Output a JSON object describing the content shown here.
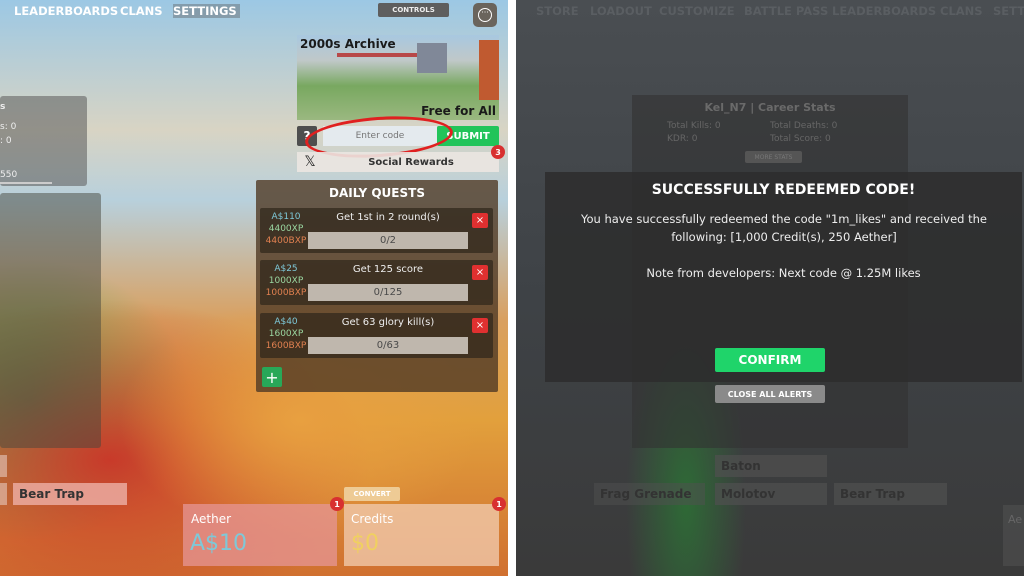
{
  "left": {
    "nav": [
      "LEADERBOARDS",
      "CLANS",
      "SETTINGS"
    ],
    "controls_label": "CONTROLS",
    "menu_icon": "ellipsis-icon",
    "map": {
      "name": "2000s Archive",
      "mode": "Free for All"
    },
    "code": {
      "placeholder": "Enter code",
      "submit": "SUBMIT",
      "help_icon": "question-icon"
    },
    "social": {
      "label": "Social Rewards",
      "icon": "x-logo-icon",
      "badge": "3"
    },
    "stats_partial": [
      "s",
      "s: 0",
      ": 0",
      "550"
    ],
    "quests": {
      "title": "DAILY QUESTS",
      "items": [
        {
          "aether": "A$110",
          "xp": "4400XP",
          "bxp": "4400BXP",
          "task": "Get 1st in 2 round(s)",
          "progress": "0/2"
        },
        {
          "aether": "A$25",
          "xp": "1000XP",
          "bxp": "1000BXP",
          "task": "Get 125 score",
          "progress": "0/125"
        },
        {
          "aether": "A$40",
          "xp": "1600XP",
          "bxp": "1600BXP",
          "task": "Get 63 glory kill(s)",
          "progress": "0/63"
        }
      ],
      "remove_label": "×",
      "add_label": "+"
    },
    "loadout_item": "Bear Trap",
    "currency": {
      "convert": "CONVERT",
      "aether": {
        "label": "Aether",
        "value": "A$10",
        "badge": "1"
      },
      "credits": {
        "label": "Credits",
        "value": "$0",
        "badge": "1"
      }
    }
  },
  "right": {
    "nav": [
      "STORE",
      "LOADOUT",
      "CUSTOMIZE",
      "BATTLE PASS",
      "LEADERBOARDS",
      "CLANS",
      "SETTI"
    ],
    "career": {
      "title": "Kel_N7 | Career Stats",
      "kills": "Total Kills: 0",
      "deaths": "Total Deaths: 0",
      "kdr": "KDR: 0",
      "score": "Total Score: 0",
      "more": "MORE STATS"
    },
    "alert": {
      "title": "SUCCESSFULLY REDEEMED CODE!",
      "message": "You have successfully redeemed the code \"1m_likes\" and received the following: [1,000 Credit(s), 250 Aether]",
      "note": "Note from developers: Next code @ 1.25M likes",
      "confirm": "CONFIRM",
      "close_all": "CLOSE ALL ALERTS"
    },
    "loadout": [
      "Baton",
      "Frag Grenade",
      "Molotov",
      "Bear Trap"
    ],
    "partial_card": "Ae"
  },
  "colors": {
    "submit": "#22c45a",
    "confirm": "#1fd46a",
    "aether": "#7ec8d8",
    "credits": "#f0d060",
    "bxp": "#e08050",
    "xp": "#9ad6a0"
  }
}
